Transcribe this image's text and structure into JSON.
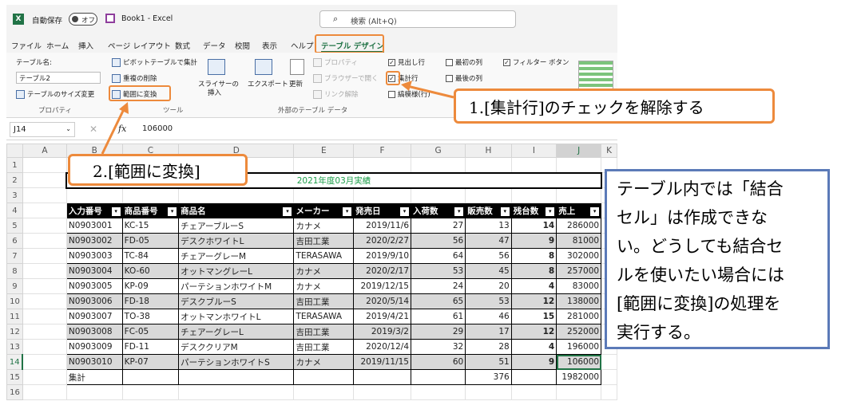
{
  "titlebar": {
    "autosave_label": "自動保存",
    "toggle_label": "オフ",
    "book_title": "Book1  -  Excel",
    "search_placeholder": "検索 (Alt+Q)"
  },
  "menu": {
    "tabs": [
      "ファイル",
      "ホーム",
      "挿入",
      "ページ レイアウト",
      "数式",
      "データ",
      "校閲",
      "表示",
      "ヘルプ",
      "テーブル デザイン"
    ]
  },
  "ribbon": {
    "table_name_label": "テーブル名:",
    "table_name_value": "テーブル2",
    "resize_table": "テーブルのサイズ変更",
    "group_properties": "プロパティ",
    "pivot_summary": "ピボットテーブルで集計",
    "remove_duplicates": "重複の削除",
    "convert_to_range": "範囲に変換",
    "slicer_line1": "スライサーの",
    "slicer_line2": "挿入",
    "group_tools": "ツール",
    "export": "エクスポート",
    "refresh": "更新",
    "properties": "プロパティ",
    "open_browser": "ブラウザーで開く",
    "unlink": "リンク解除",
    "group_external": "外部のテーブル データ",
    "header_row": "見出し行",
    "total_row": "集計行",
    "banded_rows": "縞模様(行)",
    "first_column": "最初の列",
    "last_column": "最後の列",
    "filter_button": "フィルター ボタン"
  },
  "formula_bar": {
    "name_box": "J14",
    "fx": "fx",
    "value": "106000"
  },
  "sheet": {
    "columns": [
      "A",
      "B",
      "C",
      "D",
      "E",
      "F",
      "G",
      "H",
      "I",
      "J",
      "K"
    ],
    "row_numbers": [
      "1",
      "2",
      "3",
      "4",
      "5",
      "6",
      "7",
      "8",
      "9",
      "10",
      "11",
      "12",
      "13",
      "14",
      "15",
      "16"
    ],
    "banner": "2021年度03月実績",
    "headers": [
      "入力番号",
      "商品番号",
      "商品名",
      "メーカー",
      "発売日",
      "入荷数",
      "販売数",
      "残台数",
      "売上"
    ],
    "rows": [
      [
        "N0903001",
        "KC-15",
        "チェアーブルーS",
        "カナメ",
        "2019/11/6",
        "27",
        "13",
        "14",
        "286000"
      ],
      [
        "N0903002",
        "FD-05",
        "デスクホワイトL",
        "吉田工業",
        "2020/2/27",
        "56",
        "47",
        "9",
        "81000"
      ],
      [
        "N0903003",
        "TC-84",
        "チェアーグレーM",
        "TERASAWA",
        "2019/9/10",
        "64",
        "56",
        "8",
        "302000"
      ],
      [
        "N0903004",
        "KO-60",
        "オットマングレーL",
        "カナメ",
        "2020/2/17",
        "53",
        "45",
        "8",
        "257000"
      ],
      [
        "N0903005",
        "KP-09",
        "パーテションホワイトM",
        "カナメ",
        "2019/12/15",
        "24",
        "20",
        "4",
        "83000"
      ],
      [
        "N0903006",
        "FD-18",
        "デスクブルーS",
        "吉田工業",
        "2020/5/14",
        "65",
        "53",
        "12",
        "138000"
      ],
      [
        "N0903007",
        "TO-38",
        "オットマンホワイトL",
        "TERASAWA",
        "2019/4/21",
        "61",
        "46",
        "15",
        "281000"
      ],
      [
        "N0903008",
        "FC-05",
        "チェアーグレーL",
        "吉田工業",
        "2019/3/2",
        "29",
        "17",
        "12",
        "252000"
      ],
      [
        "N0903009",
        "FD-11",
        "デスククリアM",
        "吉田工業",
        "2020/12/4",
        "32",
        "28",
        "4",
        "196000"
      ],
      [
        "N0903010",
        "KP-07",
        "パーテションホワイトS",
        "カナメ",
        "2019/11/15",
        "60",
        "51",
        "9",
        "106000"
      ]
    ],
    "total_label": "集計",
    "total_sales_count": "376",
    "total_revenue": "1982000"
  },
  "annotations": {
    "step1": "1.[集計行]のチェックを解除する",
    "step2": "2.[範囲に変換]",
    "note_lines": [
      "テーブル内では「結合",
      "セル」は作成できな",
      "い。どうしても結合セ",
      "ルを使いたい場合には",
      "[範囲に変換]の処理を",
      "実行する。"
    ]
  },
  "colors": {
    "callout_border": "#ed8a3c",
    "note_border": "#5b7ab8",
    "banner_text": "#1e9e4a",
    "excel_green": "#217346"
  }
}
